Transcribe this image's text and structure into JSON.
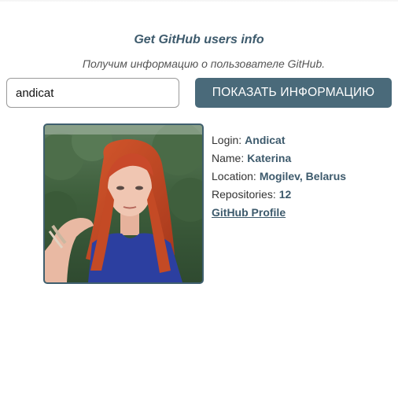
{
  "header": {
    "title": "Get GitHub users info",
    "subtitle": "Получим информацию о пользователе GitHub."
  },
  "search": {
    "value": "andicat",
    "button_label": "ПОКАЗАТЬ ИНФОРМАЦИЮ"
  },
  "profile": {
    "avatar": "user-avatar-photo",
    "login_label": "Login:",
    "login": "Andicat",
    "name_label": "Name:",
    "name": "Katerina",
    "location_label": "Location:",
    "location": "Mogilev, Belarus",
    "repos_label": "Repositories:",
    "repos": "12",
    "link_label": "GitHub Profile"
  },
  "colors": {
    "accent": "#3d5a6c",
    "button": "#4a6a7a"
  }
}
